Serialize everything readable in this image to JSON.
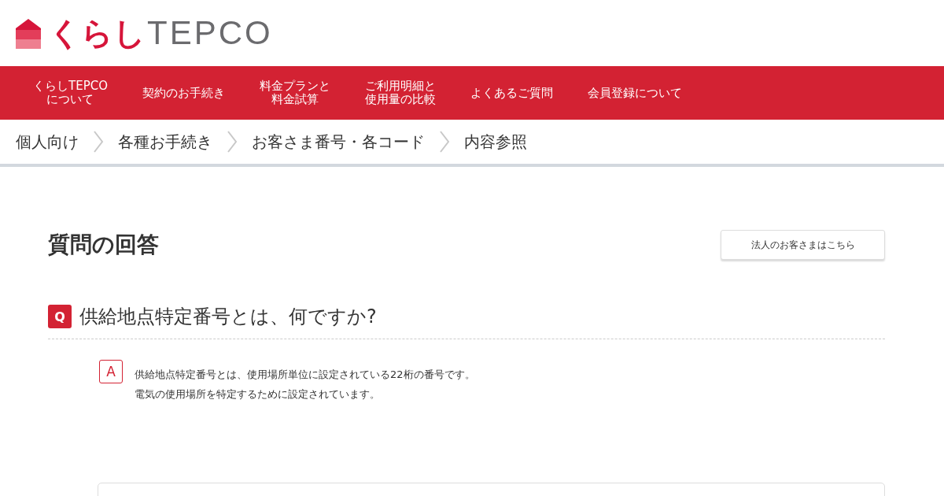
{
  "logo": {
    "kana": "くらし",
    "latin": "TEPCO"
  },
  "nav": [
    {
      "lines": [
        "くらしTEPCO",
        "について"
      ]
    },
    {
      "lines": [
        "契約のお手続き"
      ]
    },
    {
      "lines": [
        "料金プランと",
        "料金試算"
      ]
    },
    {
      "lines": [
        "ご利用明細と",
        "使用量の比較"
      ]
    },
    {
      "lines": [
        "よくあるご質問"
      ]
    },
    {
      "lines": [
        "会員登録について"
      ]
    }
  ],
  "breadcrumbs": [
    "個人向け",
    "各種お手続き",
    "お客さま番号・各コード",
    "内容参照"
  ],
  "page_title": "質問の回答",
  "corporate_button": "法人のお客さまはこちら",
  "question": {
    "mark": "Q",
    "text": "供給地点特定番号とは、何ですか?"
  },
  "answer": {
    "mark": "A",
    "lines": [
      "供給地点特定番号とは、使用場所単位に設定されている22桁の番号です。",
      "電気の使用場所を特定するために設定されています。"
    ]
  }
}
